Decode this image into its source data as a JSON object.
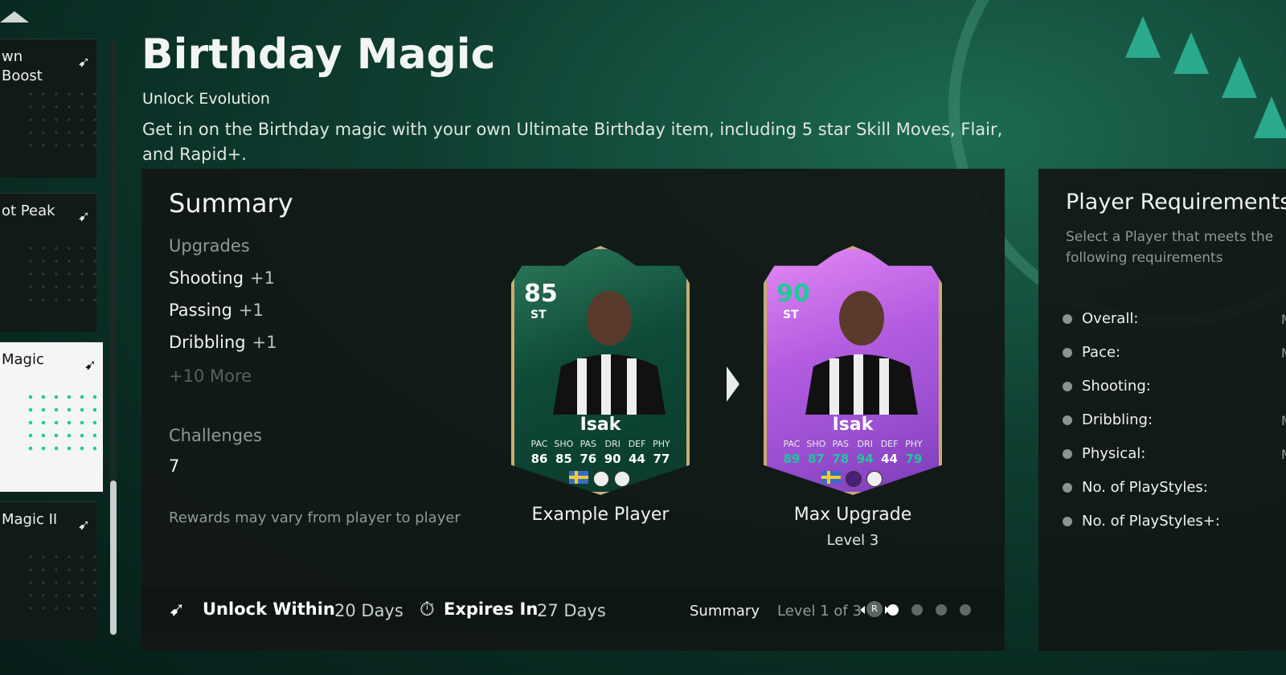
{
  "sidebar": {
    "items": [
      {
        "label": "wn\nBoost",
        "selected": false
      },
      {
        "label": "ot Peak",
        "selected": false
      },
      {
        "label": "Magic",
        "selected": true
      },
      {
        "label": "Magic II",
        "selected": false
      }
    ]
  },
  "header": {
    "title": "Birthday Magic",
    "subtitle": "Unlock Evolution",
    "description": "Get in on the Birthday magic with your own Ultimate Birthday item, including 5 star Skill Moves, Flair, and Rapid+."
  },
  "summary": {
    "heading": "Summary",
    "upgrades_label": "Upgrades",
    "upgrades": [
      {
        "name": "Shooting",
        "value": "+1"
      },
      {
        "name": "Passing",
        "value": "+1"
      },
      {
        "name": "Dribbling",
        "value": "+1"
      }
    ],
    "more": "+10 More",
    "challenges_label": "Challenges",
    "challenges_value": "7",
    "note": "Rewards may vary from player to player"
  },
  "cards": {
    "example": {
      "rating": "85",
      "position": "ST",
      "name": "Isak",
      "stat_labels": [
        "PAC",
        "SHO",
        "PAS",
        "DRI",
        "DEF",
        "PHY"
      ],
      "stat_values": [
        "86",
        "85",
        "76",
        "90",
        "44",
        "77"
      ],
      "caption": "Example Player"
    },
    "max": {
      "rating": "90",
      "position": "ST",
      "name": "Isak",
      "stat_labels": [
        "PAC",
        "SHO",
        "PAS",
        "DRI",
        "DEF",
        "PHY"
      ],
      "stat_values": [
        "89",
        "87",
        "78",
        "94",
        "44",
        "79"
      ],
      "caption": "Max Upgrade",
      "level": "Level 3"
    }
  },
  "footer": {
    "unlock_label": "Unlock Within",
    "unlock_value": "20 Days",
    "expires_label": "Expires In",
    "expires_value": "27 Days",
    "summary_tab": "Summary",
    "level_text": "Level 1 of 3",
    "r_button": "R",
    "pager_active": 0,
    "pager_count": 4
  },
  "requirements": {
    "heading": "Player Requirements",
    "description": "Select a Player that meets the following requirements",
    "items": [
      {
        "label": "Overall:",
        "value": "M"
      },
      {
        "label": "Pace:",
        "value": "M"
      },
      {
        "label": "Shooting:",
        "value": ""
      },
      {
        "label": "Dribbling:",
        "value": "M"
      },
      {
        "label": "Physical:",
        "value": "M"
      },
      {
        "label": "No. of PlayStyles:",
        "value": ""
      },
      {
        "label": "No. of PlayStyles+:",
        "value": ""
      }
    ]
  },
  "colors": {
    "accent": "#1fc99b",
    "panel": "#121816",
    "bg": "#0f3e31"
  }
}
